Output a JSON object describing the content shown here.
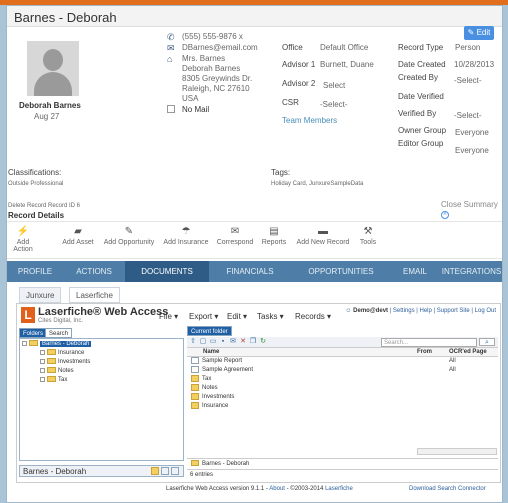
{
  "header": {
    "title": "Barnes - Deborah",
    "edit_label": "Edit"
  },
  "profile": {
    "name": "Deborah Barnes",
    "date": "Aug 27"
  },
  "contact": {
    "phone": "(555) 555-9876 x",
    "email": "DBarnes@email.com",
    "address_lines": [
      "Mrs. Barnes",
      "Deborah Barnes",
      "8305 Greywinds Dr.",
      "Raleigh, NC 27610",
      "USA"
    ],
    "no_mail": "No Mail"
  },
  "office": {
    "office_label": "Office",
    "office_value": "Default Office",
    "advisor1_label": "Advisor 1",
    "advisor1_value": "Burnett, Duane",
    "advisor2_label": "Advisor 2",
    "advisor2_value": "Select",
    "csr_label": "CSR",
    "csr_value": "-Select-",
    "team_members": "Team Members"
  },
  "record": {
    "type_label": "Record Type",
    "type_value": "Person",
    "created_label": "Date Created",
    "created_value": "10/28/2013",
    "createdby_label": "Created By",
    "createdby_value": "-Select-",
    "verified_label": "Date Verified",
    "verifiedby_label": "Verified By",
    "verifiedby_value": "-Select-",
    "owner_label": "Owner Group",
    "owner_value": "Everyone",
    "editor_label": "Editor Group",
    "editor_value": "Everyone"
  },
  "classifications": {
    "label": "Classifications:",
    "value": "Outside Professional"
  },
  "tags": {
    "label": "Tags:",
    "value": "Holiday Card, JunxureSampleData"
  },
  "record_links": {
    "delete": "Delete Record",
    "record_id": "Record ID 6",
    "close_summary": "Close Summary",
    "section": "Record Details"
  },
  "actions": [
    {
      "label": "Add Action",
      "icon": "lightning-icon",
      "glyph": "⚡"
    },
    {
      "label": "Add Asset",
      "icon": "asset-icon",
      "glyph": "▰"
    },
    {
      "label": "Add Opportunity",
      "icon": "opportunity-icon",
      "glyph": "✎"
    },
    {
      "label": "Add Insurance",
      "icon": "umbrella-icon",
      "glyph": "☂"
    },
    {
      "label": "Correspond",
      "icon": "envelope-icon",
      "glyph": "✉"
    },
    {
      "label": "Reports",
      "icon": "report-icon",
      "glyph": "▤"
    },
    {
      "label": "Add New Record",
      "icon": "folder-icon",
      "glyph": "▬"
    },
    {
      "label": "Tools",
      "icon": "tools-icon",
      "glyph": "⚒"
    }
  ],
  "tabs": [
    "PROFILE",
    "ACTIONS",
    "DOCUMENTS",
    "FINANCIALS",
    "OPPORTUNITIES",
    "EMAIL",
    "INTEGRATIONS"
  ],
  "subtabs": [
    "Junxure",
    "Laserfiche"
  ],
  "laserfiche": {
    "brand": "Laserfiche® Web Access",
    "sub": "Cites Digital, Inc.",
    "menus": [
      "File ▾",
      "Export ▾",
      "Edit ▾",
      "Tasks ▾",
      "Records ▾"
    ],
    "user": "Demo@devt",
    "user_links": "| Settings | Help | Support Site | Log Out",
    "panel_tabs": [
      "Folders",
      "Search"
    ],
    "tree": [
      {
        "label": "Barnes - Deborah",
        "level": 0
      },
      {
        "label": "Insurance",
        "level": 1
      },
      {
        "label": "Investments",
        "level": 1
      },
      {
        "label": "Notes",
        "level": 1
      },
      {
        "label": "Tax",
        "level": 1
      }
    ],
    "current_folder": "Current folder",
    "search_placeholder": "Search...",
    "columns": {
      "name": "Name",
      "from": "From",
      "ocr": "OCR'ed Page"
    },
    "rows": [
      {
        "name": "Sample Report",
        "type": "doc",
        "ocr": "All"
      },
      {
        "name": "Sample Agreement",
        "type": "doc",
        "ocr": "All"
      },
      {
        "name": "Tax",
        "type": "folder",
        "ocr": ""
      },
      {
        "name": "Notes",
        "type": "folder",
        "ocr": ""
      },
      {
        "name": "Investments",
        "type": "folder",
        "ocr": ""
      },
      {
        "name": "Insurance",
        "type": "folder",
        "ocr": ""
      }
    ],
    "breadcrumb": "Barnes - Deborah",
    "entries": "6 entries",
    "bottom_name": "Barnes - Deborah",
    "footer_version": "Laserfiche Web Access version 9.1.1 - ",
    "footer_about": "About",
    "footer_copy": " - ©2003-2014 ",
    "footer_brand": "Laserfiche",
    "footer_download": "Download Search Connector"
  }
}
